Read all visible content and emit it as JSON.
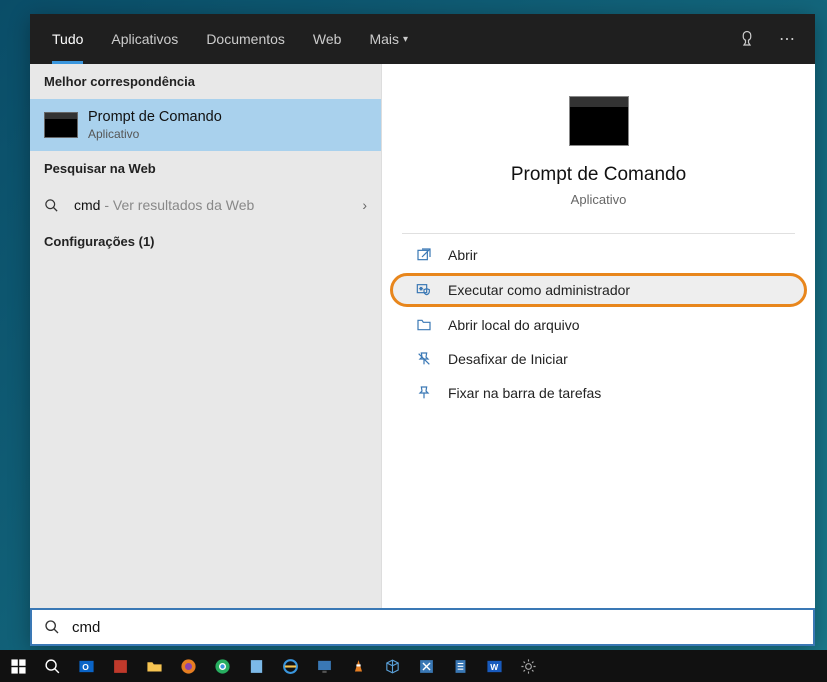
{
  "tabs": {
    "all": "Tudo",
    "apps": "Aplicativos",
    "docs": "Documentos",
    "web": "Web",
    "more": "Mais"
  },
  "sections": {
    "best_match": "Melhor correspondência",
    "web_search": "Pesquisar na Web",
    "settings": "Configurações (1)"
  },
  "best_match": {
    "title": "Prompt de Comando",
    "subtitle": "Aplicativo"
  },
  "web_result": {
    "query": "cmd",
    "hint": " - Ver resultados da Web"
  },
  "preview": {
    "title": "Prompt de Comando",
    "subtitle": "Aplicativo"
  },
  "actions": {
    "open": "Abrir",
    "run_admin": "Executar como administrador",
    "open_location": "Abrir local do arquivo",
    "unpin_start": "Desafixar de Iniciar",
    "pin_taskbar": "Fixar na barra de tarefas"
  },
  "search": {
    "value": "cmd"
  }
}
